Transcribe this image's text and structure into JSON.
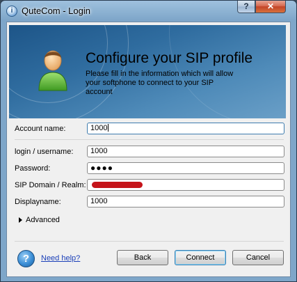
{
  "window": {
    "title": "QuteCom - Login"
  },
  "titlebar": {
    "help_glyph": "?",
    "close_glyph": "✕"
  },
  "banner": {
    "title": "Configure your SIP profile",
    "description": "Please fill in the information which will allow your softphone to connect to your SIP account"
  },
  "form": {
    "account_name": {
      "label": "Account name:",
      "value": "1000"
    },
    "login": {
      "label": "login / username:",
      "value": "1000"
    },
    "password": {
      "label": "Password:",
      "value": "●●●●"
    },
    "sip_domain": {
      "label": "SIP Domain / Realm:",
      "value": ""
    },
    "displayname": {
      "label": "Displayname:",
      "value": "1000"
    },
    "advanced_label": "Advanced"
  },
  "footer": {
    "help_glyph": "?",
    "help_link": "Need help?",
    "back_label": "Back",
    "connect_label": "Connect",
    "cancel_label": "Cancel"
  },
  "icons": {
    "app": "qutecom-app-icon",
    "avatar": "user-avatar-icon",
    "help": "help-icon",
    "advanced": "expand-triangle-icon"
  },
  "colors": {
    "banner": "#2f6c9f",
    "redaction": "#c5141a",
    "link": "#1a3fb8"
  }
}
